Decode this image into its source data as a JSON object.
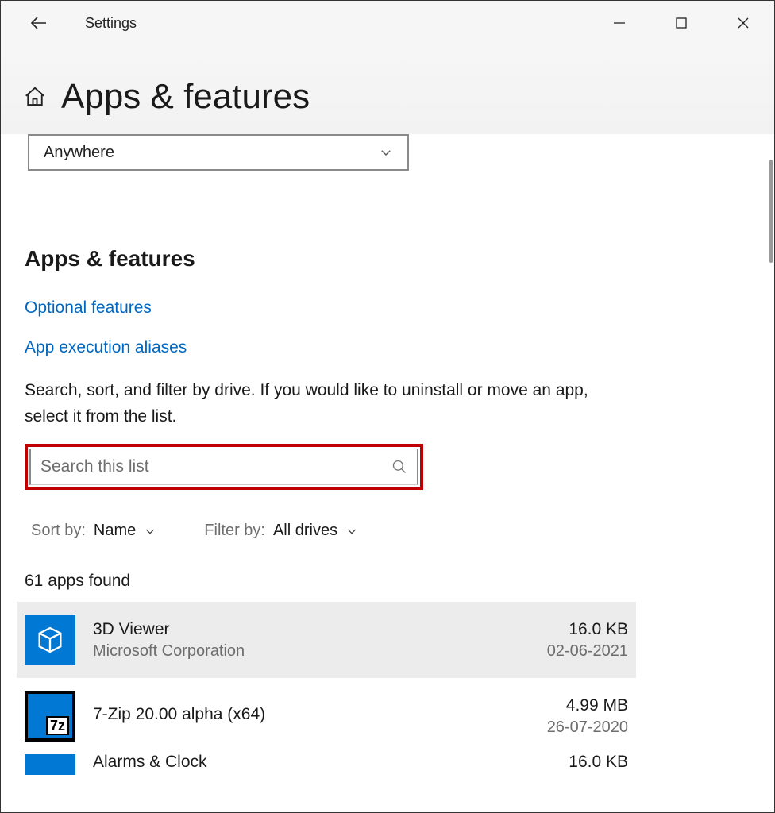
{
  "window": {
    "title": "Settings"
  },
  "page": {
    "title": "Apps & features",
    "dropdown_value": "Anywhere"
  },
  "section": {
    "heading": "Apps & features",
    "link_optional": "Optional features",
    "link_alias": "App execution aliases",
    "description": "Search, sort, and filter by drive. If you would like to uninstall or move an app, select it from the list."
  },
  "search": {
    "placeholder": "Search this list",
    "value": ""
  },
  "sort": {
    "label": "Sort by:",
    "value": "Name"
  },
  "filter": {
    "label": "Filter by:",
    "value": "All drives"
  },
  "count_text": "61 apps found",
  "apps": [
    {
      "name": "3D Viewer",
      "publisher": "Microsoft Corporation",
      "size": "16.0 KB",
      "date": "02-06-2021",
      "selected": true
    },
    {
      "name": "7-Zip 20.00 alpha (x64)",
      "publisher": "",
      "size": "4.99 MB",
      "date": "26-07-2020",
      "selected": false
    }
  ],
  "partial": {
    "name": "Alarms & Clock",
    "size": "16.0 KB"
  },
  "colors": {
    "accent": "#0078d4",
    "link": "#0067c0",
    "highlight_border": "#c00000"
  }
}
